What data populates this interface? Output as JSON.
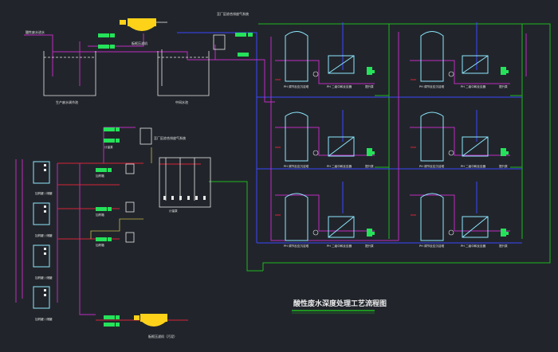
{
  "drawing": {
    "title": "酸性废水深度处理工艺流程图",
    "top_pipe_label": "至厂区综合排放气系统",
    "mid_pipe_label": "至厂区综合排放气系统",
    "tank_left_label": "生产废水调节池",
    "tank_right_label": "中间水池",
    "filter_press_label": "板框压滤机",
    "bottom_press_label": "板框压滤机（污泥）",
    "tower_label": "PH 调节反应沉淀塔",
    "box_label": "PH 二级中和反应器",
    "pump_label": "提升泵",
    "dosing_label": "加药箱",
    "small_pump_label": "计量泵",
    "left_label": "加药罐 / 储罐",
    "inlet_label": "酸性废水进水"
  },
  "colors": {
    "background": "#21252b",
    "pipe_purple": "#c02cc0",
    "pipe_blue": "#3a48ff",
    "pipe_green": "#1fb81f",
    "pipe_red": "#d6223a",
    "equipment": "#8ee8ff",
    "white": "#e8e8e8",
    "pump": "#25e25a",
    "press": "#ffd21a",
    "label": "#e9e9e9"
  }
}
